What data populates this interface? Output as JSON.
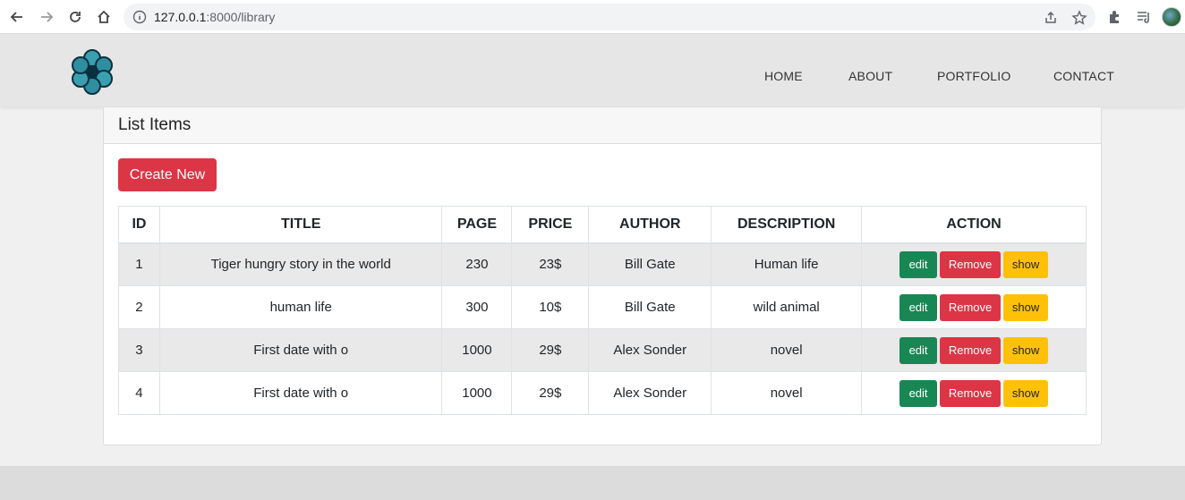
{
  "browser": {
    "url_host": "127.0.0.1",
    "url_path": ":8000/library",
    "icons": [
      "back-icon",
      "forward-icon",
      "reload-icon",
      "home-icon",
      "info-icon",
      "share-icon",
      "star-icon",
      "puzzle-icon",
      "media-icon"
    ]
  },
  "header": {
    "nav": [
      "HOME",
      "ABOUT",
      "PORTFOLIO",
      "CONTACT"
    ]
  },
  "card": {
    "title": "List Items",
    "create_label": "Create New"
  },
  "table": {
    "columns": [
      "ID",
      "TITLE",
      "PAGE",
      "PRICE",
      "AUTHOR",
      "DESCRIPTION",
      "ACTION"
    ],
    "rows": [
      [
        "1",
        "Tiger hungry story in the world",
        "230",
        "23$",
        "Bill Gate",
        "Human life"
      ],
      [
        "2",
        "human life",
        "300",
        "10$",
        "Bill Gate",
        "wild animal"
      ],
      [
        "3",
        "First date with o",
        "1000",
        "29$",
        "Alex Sonder",
        "novel"
      ],
      [
        "4",
        "First date with o",
        "1000",
        "29$",
        "Alex Sonder",
        "novel"
      ]
    ],
    "actions": {
      "edit": "edit",
      "remove": "Remove",
      "show": "show"
    }
  },
  "colors": {
    "danger": "#dc3545",
    "success": "#198754",
    "warning": "#ffc107"
  }
}
